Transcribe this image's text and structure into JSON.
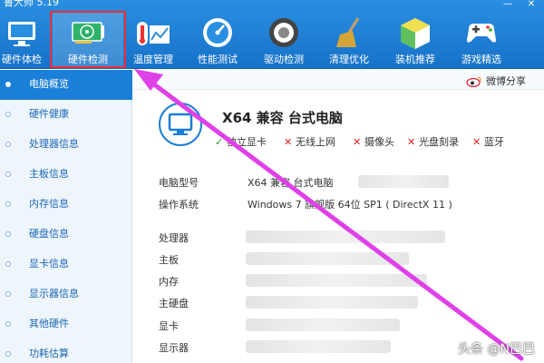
{
  "app": {
    "title": "鲁大师 5.19"
  },
  "toolbar": {
    "items": [
      {
        "label": "硬件体检",
        "icon": "monitor-icon"
      },
      {
        "label": "硬件检测",
        "icon": "graphics-card-icon",
        "active": true
      },
      {
        "label": "温度管理",
        "icon": "thermometer-icon"
      },
      {
        "label": "性能测试",
        "icon": "speedometer-icon"
      },
      {
        "label": "驱动检测",
        "icon": "driver-gear-icon"
      },
      {
        "label": "清理优化",
        "icon": "broom-icon"
      },
      {
        "label": "装机推荐",
        "icon": "box-icon"
      },
      {
        "label": "游戏精选",
        "icon": "gamepad-icon"
      }
    ]
  },
  "sidebar": {
    "items": [
      {
        "label": "电脑概览",
        "active": true
      },
      {
        "label": "硬件健康"
      },
      {
        "label": "处理器信息"
      },
      {
        "label": "主板信息"
      },
      {
        "label": "内存信息"
      },
      {
        "label": "硬盘信息"
      },
      {
        "label": "显卡信息"
      },
      {
        "label": "显示器信息"
      },
      {
        "label": "其他硬件"
      },
      {
        "label": "功耗估算"
      }
    ]
  },
  "share": {
    "label": "微博分享"
  },
  "overview": {
    "title": "X64 兼容 台式电脑",
    "flags": [
      {
        "label": "独立显卡",
        "ok": true
      },
      {
        "label": "无线上网",
        "ok": false
      },
      {
        "label": "摄像头",
        "ok": false
      },
      {
        "label": "光盘刻录",
        "ok": false
      },
      {
        "label": "蓝牙",
        "ok": false
      }
    ],
    "rows": [
      {
        "key": "电脑型号",
        "value": "X64 兼容 台式电脑"
      },
      {
        "key": "操作系统",
        "value": "Windows 7 旗舰版 64位 SP1 ( DirectX 11 )"
      },
      {
        "key": "处理器",
        "value": ""
      },
      {
        "key": "主板",
        "value": ""
      },
      {
        "key": "内存",
        "value": ""
      },
      {
        "key": "主硬盘",
        "value": ""
      },
      {
        "key": "显卡",
        "value": ""
      },
      {
        "key": "显示器",
        "value": ""
      }
    ]
  },
  "watermark": "头条 @N巴巴",
  "colors": {
    "toolbar": "#1672c9",
    "accent": "#1a7fd7",
    "highlight": "#e8303a",
    "arrow": "#e040e8"
  }
}
